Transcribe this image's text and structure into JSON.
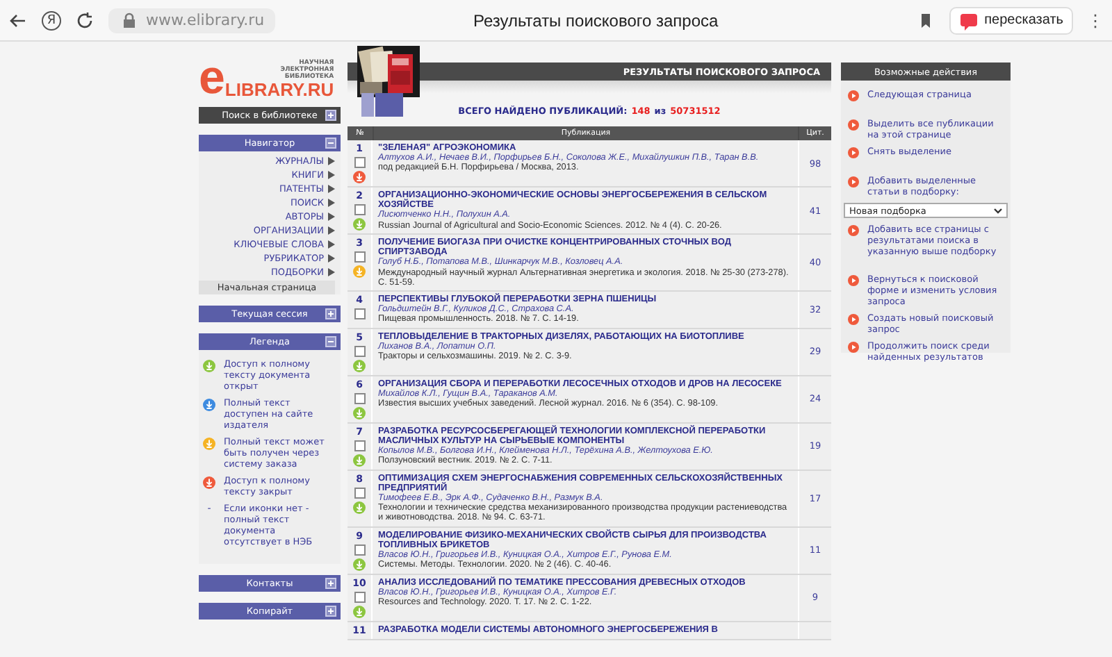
{
  "browser": {
    "logo": "Я",
    "url": "www.elibrary.ru",
    "title": "Результаты поискового запроса",
    "retell_button": "пересказать",
    "menu": "⋮"
  },
  "logo": {
    "mark": "e",
    "name": "LIBRARY.RU",
    "tagline": "НАУЧНАЯ ЭЛЕКТРОННАЯ БИБЛИОТЕКА"
  },
  "sidebar": [
    {
      "title": "Поиск в библиотеке",
      "kind": "dark",
      "expanded": false
    },
    {
      "title": "Навигатор",
      "kind": "nav",
      "expanded": true,
      "items": [
        "ЖУРНАЛЫ",
        "КНИГИ",
        "ПАТЕНТЫ",
        "ПОИСК",
        "АВТОРЫ",
        "ОРГАНИЗАЦИИ",
        "КЛЮЧЕВЫЕ СЛОВА",
        "РУБРИКАТОР",
        "ПОДБОРКИ"
      ],
      "home": "Начальная страница"
    },
    {
      "title": "Текущая сессия",
      "kind": "plain",
      "expanded": false
    },
    {
      "title": "Легенда",
      "kind": "legend",
      "expanded": true,
      "entries": [
        {
          "kind": "open",
          "text": "Доступ к полному тексту документа открыт"
        },
        {
          "kind": "publisher",
          "text": "Полный текст доступен на сайте издателя"
        },
        {
          "kind": "order",
          "text": "Полный текст может быть получен через систему заказа"
        },
        {
          "kind": "closed",
          "text": "Доступ к полному тексту закрыт"
        },
        {
          "kind": "none",
          "marker": "-",
          "text": "Если иконки нет - полный текст документа отсутствует в НЭБ"
        }
      ]
    },
    {
      "title": "Контакты",
      "kind": "plain",
      "expanded": false
    },
    {
      "title": "Копирайт",
      "kind": "plain",
      "expanded": false
    }
  ],
  "results": {
    "heading": "РЕЗУЛЬТАТЫ ПОИСКОВОГО ЗАПРОСА",
    "count_label": "ВСЕГО НАЙДЕНО ПУБЛИКАЦИЙ:",
    "found": "148",
    "separator": "из",
    "total": "50731512",
    "columns": [
      "№",
      "Публикация",
      "Цит."
    ],
    "rows": [
      {
        "number": "1",
        "checked": false,
        "kind": "closed",
        "title": "\"ЗЕЛЕНАЯ\" АГРОЭКОНОМИКА",
        "authors": "Алтухов А.И., Нечаев В.И., Порфирьев Б.Н., Соколова Ж.Е., Михайлушкин П.В., Таран В.В.",
        "source": "под редакцией Б.Н. Порфирьева / Москва, 2013.",
        "citations": "98"
      },
      {
        "number": "2",
        "checked": false,
        "kind": "open",
        "title": "ОРГАНИЗАЦИОННО-ЭКОНОМИЧЕСКИЕ ОСНОВЫ ЭНЕРГОСБЕРЕЖЕНИЯ В СЕЛЬСКОМ ХОЗЯЙСТВЕ",
        "authors": "Лисютченко Н.Н., Полухин А.А.",
        "source": "Russian Journal of Agricultural and Socio-Economic Sciences. 2012. № 4 (4). С. 20-26.",
        "citations": "41"
      },
      {
        "number": "3",
        "checked": false,
        "kind": "order",
        "title": "ПОЛУЧЕНИЕ БИОГАЗА ПРИ ОЧИСТКЕ КОНЦЕНТРИРОВАННЫХ СТОЧНЫХ ВОД СПИРТЗАВОДА",
        "authors": "Голуб Н.Б., Потапова М.В., Шинкарчук М.В., Козловец А.А.",
        "source": "Международный научный журнал Альтернативная энергетика и экология. 2018. № 25-30 (273-278). С. 51-59.",
        "citations": "40"
      },
      {
        "number": "4",
        "checked": false,
        "kind": "none",
        "title": "ПЕРСПЕКТИВЫ ГЛУБОКОЙ ПЕРЕРАБОТКИ ЗЕРНА ПШЕНИЦЫ",
        "authors": "Гольдштейн В.Г., Куликов Д.С., Страхова С.А.",
        "source": "Пищевая промышленность. 2018. № 7. С. 14-19.",
        "citations": "32"
      },
      {
        "number": "5",
        "checked": false,
        "kind": "open",
        "title": "ТЕПЛОВЫДЕЛЕНИЕ В ТРАКТОРНЫХ ДИЗЕЛЯХ, РАБОТАЮЩИХ НА БИОТОПЛИВЕ",
        "authors": "Лиханов В.А., Лопатин О.П.",
        "source": "Тракторы и сельхозмашины. 2019. № 2. С. 3-9.",
        "citations": "29"
      },
      {
        "number": "6",
        "checked": false,
        "kind": "open",
        "title": "ОРГАНИЗАЦИЯ СБОРА И ПЕРЕРАБОТКИ ЛЕСОСЕЧНЫХ ОТХОДОВ И ДРОВ НА ЛЕСОСЕКЕ",
        "authors": "Михайлов К.Л., Гущин В.А., Тараканов А.М.",
        "source": "Известия высших учебных заведений. Лесной журнал. 2016. № 6 (354). С. 98-109.",
        "citations": "24"
      },
      {
        "number": "7",
        "checked": false,
        "kind": "open",
        "title": "РАЗРАБОТКА РЕСУРСОСБЕРЕГАЮЩЕЙ ТЕХНОЛОГИИ КОМПЛЕКСНОЙ ПЕРЕРАБОТКИ МАСЛИЧНЫХ КУЛЬТУР НА СЫРЬЕВЫЕ КОМПОНЕНТЫ",
        "authors": "Копылов М.В., Болгова И.Н., Клейменова Н.Л., Терёхина А.В., Желтоухова Е.Ю.",
        "source": "Ползуновский вестник. 2019. № 2. С. 7-11.",
        "citations": "19"
      },
      {
        "number": "8",
        "checked": false,
        "kind": "open",
        "title": "ОПТИМИЗАЦИЯ СХЕМ ЭНЕРГОСНАБЖЕНИЯ СОВРЕМЕННЫХ СЕЛЬСКОХОЗЯЙСТВЕННЫХ ПРЕДПРИЯТИЙ",
        "authors": "Тимофеев Е.В., Эрк А.Ф., Судаченко В.Н., Размук В.А.",
        "source": "Технологии и технические средства механизированного производства продукции растениеводства и животноводства. 2018. № 94. С. 63-71.",
        "citations": "17"
      },
      {
        "number": "9",
        "checked": false,
        "kind": "open",
        "title": "МОДЕЛИРОВАНИЕ ФИЗИКО-МЕХАНИЧЕСКИХ СВОЙСТВ СЫРЬЯ ДЛЯ ПРОИЗВОДСТВА ТОПЛИВНЫХ БРИКЕТОВ",
        "authors": "Власов Ю.Н., Григорьев И.В., Куницкая О.А., Хитров Е.Г., Рунова Е.М.",
        "source": "Системы. Методы. Технологии. 2020. № 2 (46). С. 40-46.",
        "citations": "11"
      },
      {
        "number": "10",
        "checked": false,
        "kind": "open",
        "title": "АНАЛИЗ ИССЛЕДОВАНИЙ ПО ТЕМАТИКЕ ПРЕССОВАНИЯ ДРЕВЕСНЫХ ОТХОДОВ",
        "authors": "Власов Ю.Н., Григорьев И.В., Куницкая О.А., Хитров Е.Г.",
        "source": "Resources and Technology. 2020. Т. 17. № 2. С. 1-22.",
        "citations": "9"
      },
      {
        "number": "11",
        "title": "РАЗРАБОТКА МОДЕЛИ СИСТЕМЫ АВТОНОМНОГО ЭНЕРГОСБЕРЕЖЕНИЯ В"
      }
    ]
  },
  "actions": {
    "title": "Возможные действия",
    "groups": [
      [
        {
          "kind": "action",
          "text": "Следующая страница"
        }
      ],
      [
        {
          "kind": "action",
          "text": "Выделить все публикации на этой странице"
        },
        {
          "kind": "action",
          "text": "Снять выделение"
        }
      ],
      [
        {
          "kind": "action",
          "text": "Добавить выделенные статьи в подборку:"
        },
        {
          "kind": "select",
          "text": "Новая подборка"
        },
        {
          "kind": "action",
          "text": "Добавить все страницы с результатами поиска в указанную выше подборку"
        }
      ],
      [
        {
          "kind": "action",
          "text": "Вернуться к поисковой форме и изменить условия запроса"
        },
        {
          "kind": "action",
          "text": "Создать новый поисковый запрос"
        },
        {
          "kind": "action",
          "text": "Продолжить поиск среди найденных результатов"
        }
      ]
    ]
  }
}
